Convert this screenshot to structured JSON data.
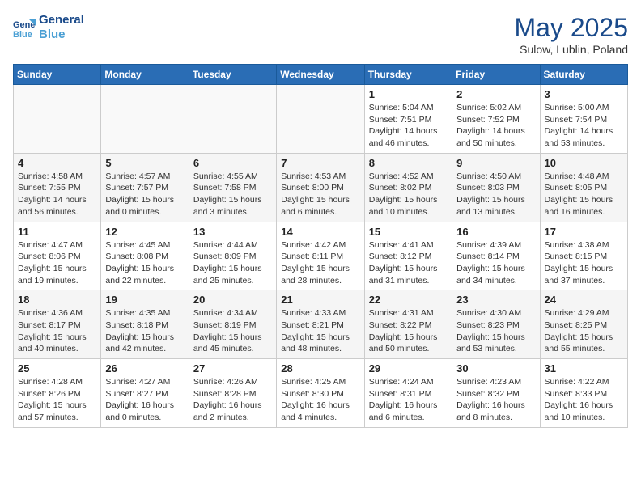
{
  "logo": {
    "line1": "General",
    "line2": "Blue"
  },
  "title": "May 2025",
  "subtitle": "Sulow, Lublin, Poland",
  "days_header": [
    "Sunday",
    "Monday",
    "Tuesday",
    "Wednesday",
    "Thursday",
    "Friday",
    "Saturday"
  ],
  "weeks": [
    [
      {
        "day": "",
        "info": ""
      },
      {
        "day": "",
        "info": ""
      },
      {
        "day": "",
        "info": ""
      },
      {
        "day": "",
        "info": ""
      },
      {
        "day": "1",
        "info": "Sunrise: 5:04 AM\nSunset: 7:51 PM\nDaylight: 14 hours\nand 46 minutes."
      },
      {
        "day": "2",
        "info": "Sunrise: 5:02 AM\nSunset: 7:52 PM\nDaylight: 14 hours\nand 50 minutes."
      },
      {
        "day": "3",
        "info": "Sunrise: 5:00 AM\nSunset: 7:54 PM\nDaylight: 14 hours\nand 53 minutes."
      }
    ],
    [
      {
        "day": "4",
        "info": "Sunrise: 4:58 AM\nSunset: 7:55 PM\nDaylight: 14 hours\nand 56 minutes."
      },
      {
        "day": "5",
        "info": "Sunrise: 4:57 AM\nSunset: 7:57 PM\nDaylight: 15 hours\nand 0 minutes."
      },
      {
        "day": "6",
        "info": "Sunrise: 4:55 AM\nSunset: 7:58 PM\nDaylight: 15 hours\nand 3 minutes."
      },
      {
        "day": "7",
        "info": "Sunrise: 4:53 AM\nSunset: 8:00 PM\nDaylight: 15 hours\nand 6 minutes."
      },
      {
        "day": "8",
        "info": "Sunrise: 4:52 AM\nSunset: 8:02 PM\nDaylight: 15 hours\nand 10 minutes."
      },
      {
        "day": "9",
        "info": "Sunrise: 4:50 AM\nSunset: 8:03 PM\nDaylight: 15 hours\nand 13 minutes."
      },
      {
        "day": "10",
        "info": "Sunrise: 4:48 AM\nSunset: 8:05 PM\nDaylight: 15 hours\nand 16 minutes."
      }
    ],
    [
      {
        "day": "11",
        "info": "Sunrise: 4:47 AM\nSunset: 8:06 PM\nDaylight: 15 hours\nand 19 minutes."
      },
      {
        "day": "12",
        "info": "Sunrise: 4:45 AM\nSunset: 8:08 PM\nDaylight: 15 hours\nand 22 minutes."
      },
      {
        "day": "13",
        "info": "Sunrise: 4:44 AM\nSunset: 8:09 PM\nDaylight: 15 hours\nand 25 minutes."
      },
      {
        "day": "14",
        "info": "Sunrise: 4:42 AM\nSunset: 8:11 PM\nDaylight: 15 hours\nand 28 minutes."
      },
      {
        "day": "15",
        "info": "Sunrise: 4:41 AM\nSunset: 8:12 PM\nDaylight: 15 hours\nand 31 minutes."
      },
      {
        "day": "16",
        "info": "Sunrise: 4:39 AM\nSunset: 8:14 PM\nDaylight: 15 hours\nand 34 minutes."
      },
      {
        "day": "17",
        "info": "Sunrise: 4:38 AM\nSunset: 8:15 PM\nDaylight: 15 hours\nand 37 minutes."
      }
    ],
    [
      {
        "day": "18",
        "info": "Sunrise: 4:36 AM\nSunset: 8:17 PM\nDaylight: 15 hours\nand 40 minutes."
      },
      {
        "day": "19",
        "info": "Sunrise: 4:35 AM\nSunset: 8:18 PM\nDaylight: 15 hours\nand 42 minutes."
      },
      {
        "day": "20",
        "info": "Sunrise: 4:34 AM\nSunset: 8:19 PM\nDaylight: 15 hours\nand 45 minutes."
      },
      {
        "day": "21",
        "info": "Sunrise: 4:33 AM\nSunset: 8:21 PM\nDaylight: 15 hours\nand 48 minutes."
      },
      {
        "day": "22",
        "info": "Sunrise: 4:31 AM\nSunset: 8:22 PM\nDaylight: 15 hours\nand 50 minutes."
      },
      {
        "day": "23",
        "info": "Sunrise: 4:30 AM\nSunset: 8:23 PM\nDaylight: 15 hours\nand 53 minutes."
      },
      {
        "day": "24",
        "info": "Sunrise: 4:29 AM\nSunset: 8:25 PM\nDaylight: 15 hours\nand 55 minutes."
      }
    ],
    [
      {
        "day": "25",
        "info": "Sunrise: 4:28 AM\nSunset: 8:26 PM\nDaylight: 15 hours\nand 57 minutes."
      },
      {
        "day": "26",
        "info": "Sunrise: 4:27 AM\nSunset: 8:27 PM\nDaylight: 16 hours\nand 0 minutes."
      },
      {
        "day": "27",
        "info": "Sunrise: 4:26 AM\nSunset: 8:28 PM\nDaylight: 16 hours\nand 2 minutes."
      },
      {
        "day": "28",
        "info": "Sunrise: 4:25 AM\nSunset: 8:30 PM\nDaylight: 16 hours\nand 4 minutes."
      },
      {
        "day": "29",
        "info": "Sunrise: 4:24 AM\nSunset: 8:31 PM\nDaylight: 16 hours\nand 6 minutes."
      },
      {
        "day": "30",
        "info": "Sunrise: 4:23 AM\nSunset: 8:32 PM\nDaylight: 16 hours\nand 8 minutes."
      },
      {
        "day": "31",
        "info": "Sunrise: 4:22 AM\nSunset: 8:33 PM\nDaylight: 16 hours\nand 10 minutes."
      }
    ]
  ]
}
